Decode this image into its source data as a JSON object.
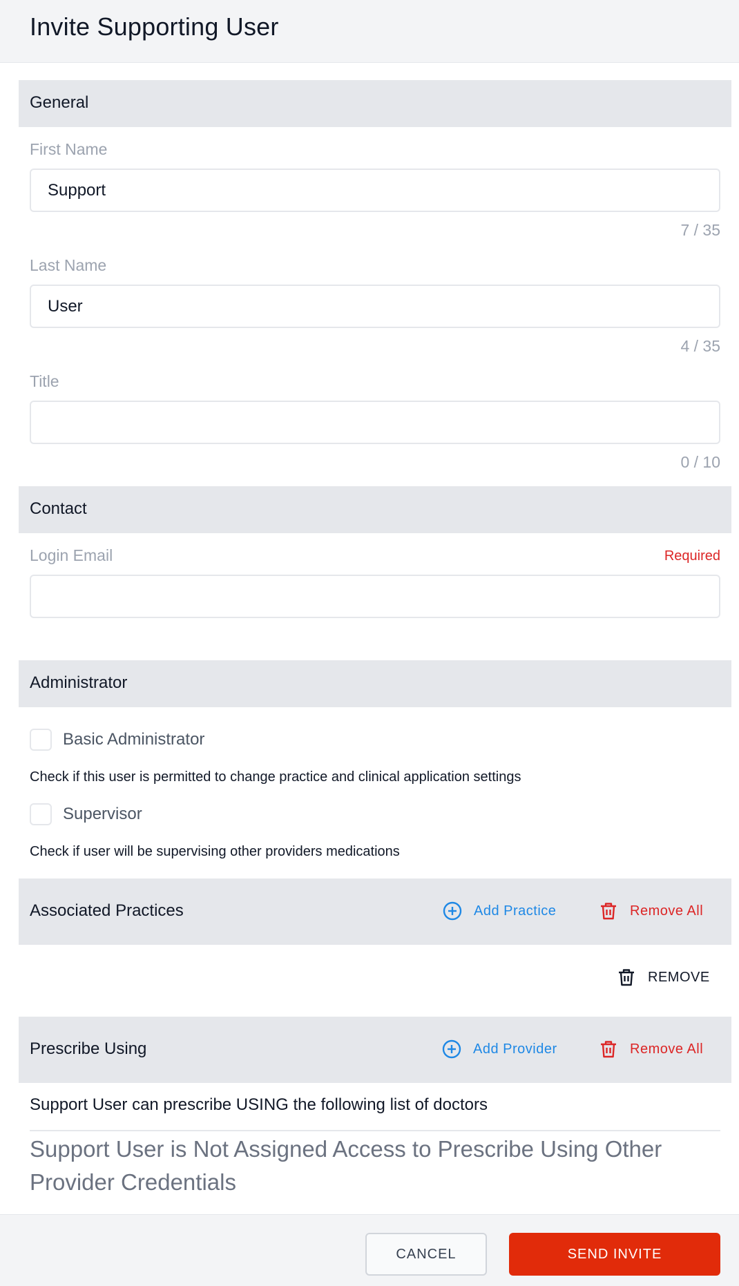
{
  "header": {
    "title": "Invite Supporting User"
  },
  "general": {
    "title": "General",
    "first_name": {
      "label": "First Name",
      "value": "Support",
      "counter": "7 / 35"
    },
    "last_name": {
      "label": "Last Name",
      "value": "User",
      "counter": "4 / 35"
    },
    "title_field": {
      "label": "Title",
      "value": "",
      "counter": "0 / 10"
    }
  },
  "contact": {
    "title": "Contact",
    "login_email": {
      "label": "Login Email",
      "required": "Required",
      "value": ""
    }
  },
  "administrator": {
    "title": "Administrator",
    "basic_admin": {
      "label": "Basic Administrator",
      "help": "Check if this user is permitted to change practice and clinical application settings"
    },
    "supervisor": {
      "label": "Supervisor",
      "help": "Check if user will be supervising other providers medications"
    }
  },
  "practices": {
    "title": "Associated Practices",
    "add_label": "Add Practice",
    "remove_all_label": "Remove All",
    "remove_label": "REMOVE"
  },
  "prescribe": {
    "title": "Prescribe Using",
    "add_label": "Add Provider",
    "remove_all_label": "Remove All",
    "description": "Support User can prescribe USING the following list of doctors",
    "empty_message": "Support User is Not Assigned Access to Prescribe Using Other Provider Credentials"
  },
  "footer": {
    "cancel_label": "CANCEL",
    "send_label": "SEND INVITE"
  },
  "colors": {
    "accent_blue": "#1e88e5",
    "danger_red": "#dc2626",
    "send_button": "#e12b0a"
  }
}
